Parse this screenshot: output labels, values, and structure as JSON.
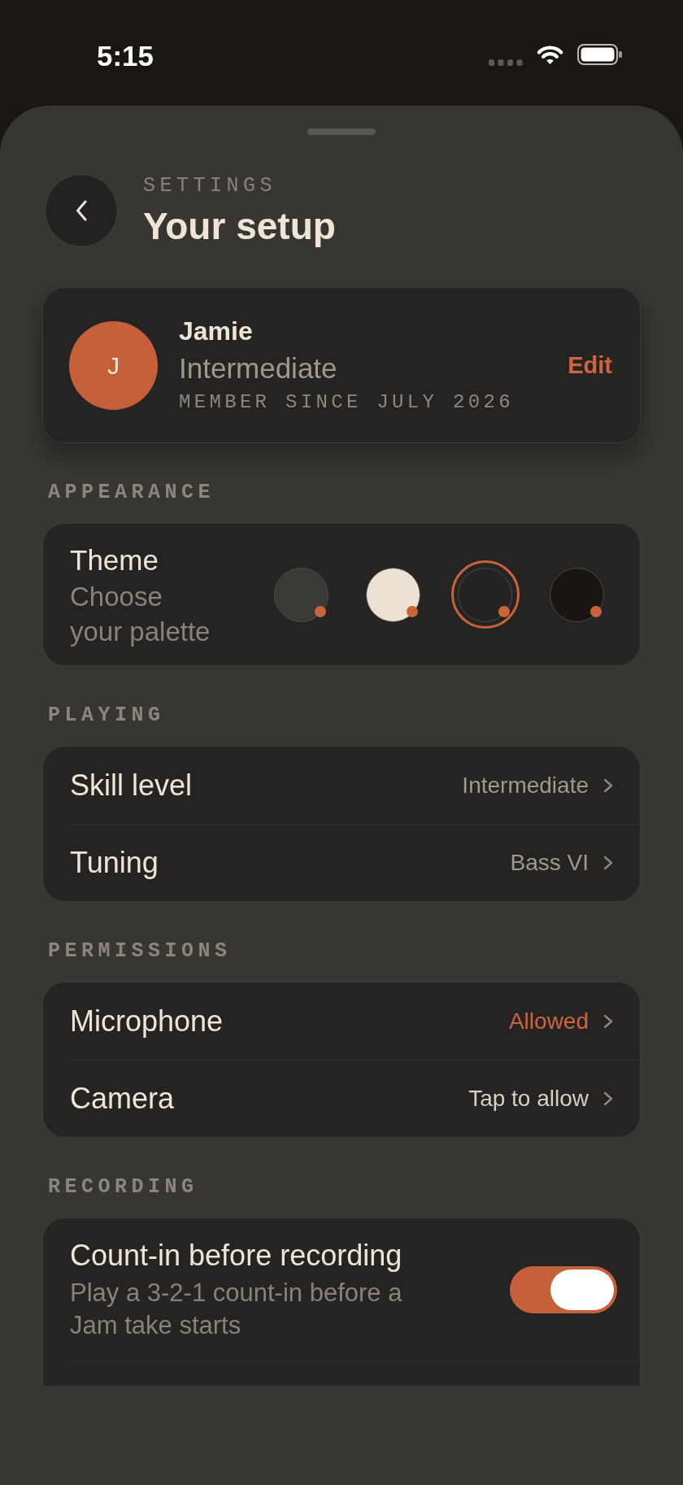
{
  "status_bar": {
    "time": "5:15"
  },
  "header": {
    "eyebrow": "SETTINGS",
    "title": "Your setup"
  },
  "profile": {
    "initial": "J",
    "name": "Jamie",
    "skill": "Intermediate",
    "member_since": "MEMBER SINCE JULY 2026",
    "edit_label": "Edit"
  },
  "sections": [
    {
      "heading": "APPEARANCE",
      "kind": "theme",
      "title": "Theme",
      "subtitle": "Choose your palette",
      "swatches": [
        {
          "color": "#3b3936",
          "selected": false
        },
        {
          "color": "#ebe2d2",
          "selected": false
        },
        {
          "color": "#252321",
          "selected": true
        },
        {
          "color": "#1a1510",
          "selected": false
        }
      ]
    },
    {
      "heading": "PLAYING",
      "kind": "list",
      "rows": [
        {
          "label": "Skill level",
          "value": "Intermediate",
          "color": "#a1988d"
        },
        {
          "label": "Tuning",
          "value": "Bass VI",
          "color": "#a1988d"
        }
      ]
    },
    {
      "heading": "PERMISSIONS",
      "kind": "list",
      "rows": [
        {
          "label": "Microphone",
          "value": "Allowed",
          "color": "#cc6540"
        },
        {
          "label": "Camera",
          "value": "Tap to allow",
          "color": "#d8cfc2"
        }
      ]
    },
    {
      "heading": "RECORDING",
      "kind": "toggles",
      "rows": [
        {
          "label": "Count-in before recording",
          "description": "Play a 3-2-1 count-in before a Jam take starts",
          "on": true
        }
      ]
    }
  ]
}
